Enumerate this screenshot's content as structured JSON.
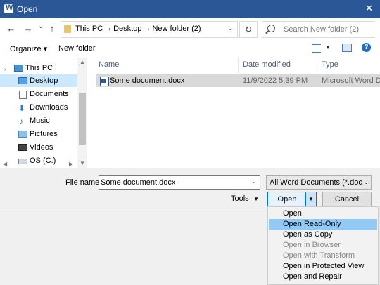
{
  "window": {
    "title": "Open",
    "app_icon_letter": "W",
    "close_glyph": "✕"
  },
  "nav": {
    "back": "←",
    "forward": "→",
    "recent": "⌄",
    "up": "↑",
    "refresh": "↻"
  },
  "address": {
    "crumbs": [
      "This PC",
      "Desktop",
      "New folder (2)"
    ],
    "separator": "›"
  },
  "search": {
    "placeholder": "Search New folder (2)"
  },
  "toolbar": {
    "organize": "Organize ▾",
    "new_folder": "New folder"
  },
  "sidebar": {
    "items": [
      {
        "label": "This PC",
        "icon": "computer-icon",
        "selected": false,
        "indent": 0
      },
      {
        "label": "Desktop",
        "icon": "desktop-icon",
        "selected": true,
        "indent": 1
      },
      {
        "label": "Documents",
        "icon": "documents-icon",
        "selected": false,
        "indent": 1
      },
      {
        "label": "Downloads",
        "icon": "downloads-icon",
        "selected": false,
        "indent": 1
      },
      {
        "label": "Music",
        "icon": "music-icon",
        "selected": false,
        "indent": 1
      },
      {
        "label": "Pictures",
        "icon": "pictures-icon",
        "selected": false,
        "indent": 1
      },
      {
        "label": "Videos",
        "icon": "videos-icon",
        "selected": false,
        "indent": 1
      },
      {
        "label": "OS (C:)",
        "icon": "drive-icon",
        "selected": false,
        "indent": 1
      }
    ]
  },
  "file_list": {
    "columns": [
      "Name",
      "Date modified",
      "Type"
    ],
    "rows": [
      {
        "name": "Some document.docx",
        "date": "11/9/2022 5:39 PM",
        "type": "Microsoft Word D..."
      }
    ]
  },
  "footer": {
    "file_name_label": "File name:",
    "file_name_value": "Some document.docx",
    "filter_value": "All Word Documents (*.docx;*.d",
    "tools_label": "Tools",
    "open_label": "Open",
    "cancel_label": "Cancel"
  },
  "open_menu": {
    "items": [
      {
        "label": "Open",
        "state": "normal"
      },
      {
        "label": "Open Read-Only",
        "state": "highlighted"
      },
      {
        "label": "Open as Copy",
        "state": "normal"
      },
      {
        "label": "Open in Browser",
        "state": "disabled"
      },
      {
        "label": "Open with Transform",
        "state": "disabled"
      },
      {
        "label": "Open in Protected View",
        "state": "normal"
      },
      {
        "label": "Open and Repair",
        "state": "normal"
      }
    ]
  },
  "colors": {
    "title_bar": "#2b5797",
    "selection": "#cce8ff",
    "menu_highlight": "#91c9f7",
    "accent": "#0078d7"
  }
}
